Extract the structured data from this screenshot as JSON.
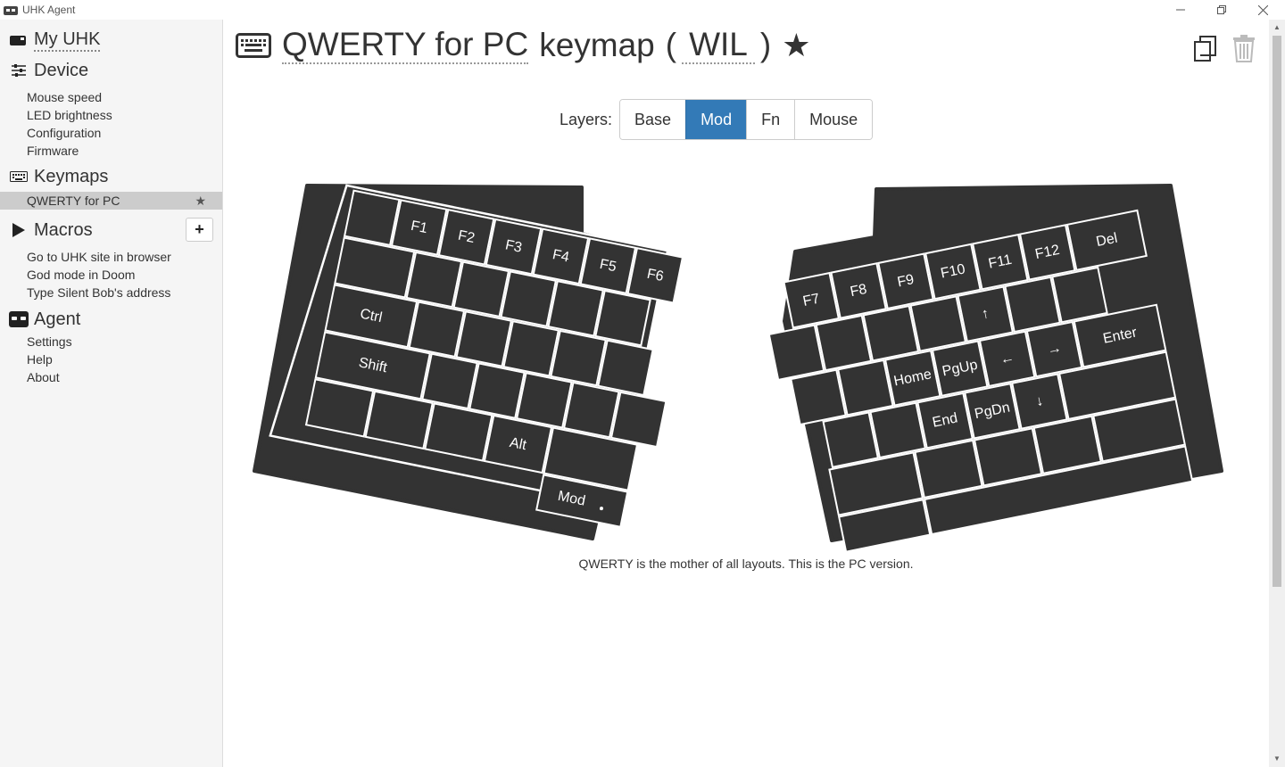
{
  "window": {
    "title": "UHK Agent"
  },
  "sidebar": {
    "my_uhk": "My UHK",
    "device": {
      "label": "Device",
      "items": [
        "Mouse speed",
        "LED brightness",
        "Configuration",
        "Firmware"
      ]
    },
    "keymaps": {
      "label": "Keymaps",
      "items": [
        {
          "label": "QWERTY for PC",
          "default": true
        }
      ]
    },
    "macros": {
      "label": "Macros",
      "add": "+",
      "items": [
        "Go to UHK site in browser",
        "God mode in Doom",
        "Type Silent Bob's address"
      ]
    },
    "agent": {
      "label": "Agent",
      "items": [
        "Settings",
        "Help",
        "About"
      ]
    }
  },
  "header": {
    "name": "QWERTY for PC",
    "word": "keymap",
    "open_paren": "(",
    "abbrev": "WIL",
    "close_paren": ")"
  },
  "layers": {
    "label": "Layers:",
    "tabs": [
      "Base",
      "Mod",
      "Fn",
      "Mouse"
    ],
    "active": "Mod"
  },
  "keyboard": {
    "left": {
      "row1": [
        "",
        "F1",
        "F2",
        "F3",
        "F4",
        "F5",
        "F6"
      ],
      "row3_first": "Ctrl",
      "row4_first": "Shift",
      "row5_alt": "Alt",
      "mod": "Mod"
    },
    "right": {
      "row1": [
        "F7",
        "F8",
        "F9",
        "F10",
        "F11",
        "F12",
        "Del"
      ],
      "up": "↑",
      "left": "←",
      "right": "→",
      "down": "↓",
      "enter": "Enter",
      "home": "Home",
      "pgup": "PgUp",
      "end": "End",
      "pgdn": "PgDn"
    }
  },
  "description": "QWERTY is the mother of all layouts. This is the PC version."
}
